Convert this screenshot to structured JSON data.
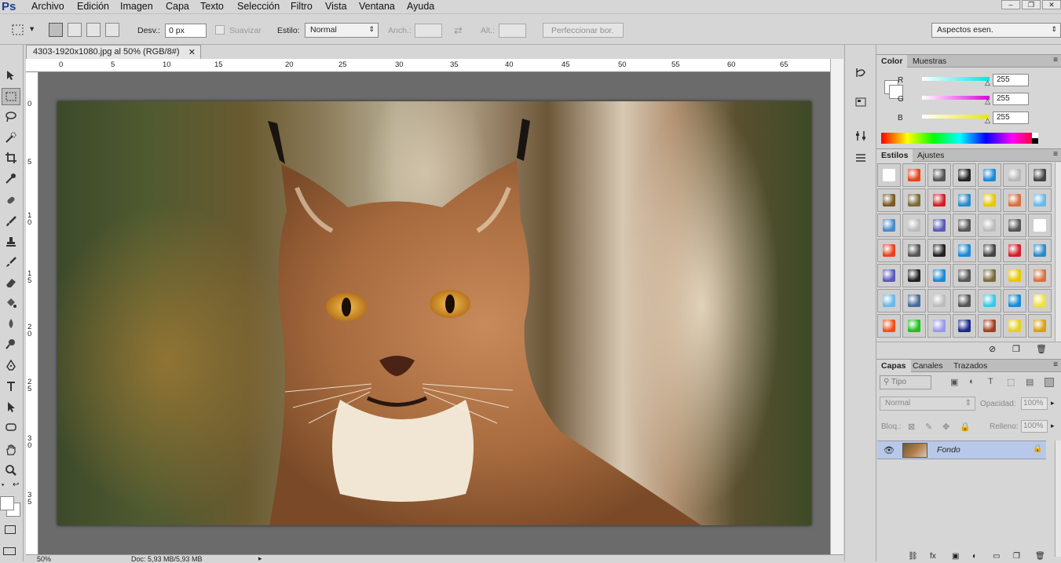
{
  "app": {
    "logo": "Ps"
  },
  "menu": [
    "Archivo",
    "Edición",
    "Imagen",
    "Capa",
    "Texto",
    "Selección",
    "Filtro",
    "Vista",
    "Ventana",
    "Ayuda"
  ],
  "options": {
    "desv_label": "Desv.:",
    "desv_value": "0 px",
    "suavizar_label": "Suavizar",
    "estilo_label": "Estilo:",
    "estilo_value": "Normal",
    "anch_label": "Anch.:",
    "alt_label": "Alt.:",
    "perfeccionar_label": "Perfeccionar bor.",
    "workspace_value": "Aspectos esen."
  },
  "document": {
    "tab_title": "4303-1920x1080.jpg al 50% (RGB/8#)",
    "zoom": "50%",
    "doc_info": "Doc: 5,93 MB/5,93 MB",
    "ruler_top": [
      "0",
      "5",
      "10",
      "15",
      "20",
      "25",
      "30",
      "35",
      "40",
      "45",
      "50",
      "55",
      "60",
      "65"
    ],
    "ruler_left": [
      "0",
      "5",
      "1 0",
      "1 5",
      "2 0",
      "2 5",
      "3 0",
      "3 5"
    ]
  },
  "color_panel": {
    "tabs": [
      "Color",
      "Muestras"
    ],
    "channels": [
      {
        "letter": "R",
        "value": "255",
        "color": "#00e5e5"
      },
      {
        "letter": "G",
        "value": "255",
        "color": "#e000e0"
      },
      {
        "letter": "B",
        "value": "255",
        "color": "#e8e800"
      }
    ]
  },
  "styles_panel": {
    "tabs": [
      "Estilos",
      "Ajustes"
    ],
    "swatches": [
      "#ffffff",
      "#e8421c",
      "#555555",
      "#222222",
      "#1a8ad4",
      "#b8b8b8",
      "#444444",
      "#7a5a2a",
      "#7a6a3a",
      "#d0202a",
      "#2a8ac8",
      "#e8c800",
      "#d87040",
      "#6ab8e8",
      "#4a8ac8",
      "#bcbcbc",
      "#5a5ab8",
      "#555555",
      "#bcbcbc",
      "#555555",
      "#ffffff",
      "#e8421c",
      "#555555",
      "#222222",
      "#1a8ad4",
      "#444444",
      "#d0202a",
      "#2a8ac8",
      "#5a5ab8",
      "#222222",
      "#1a8ad4",
      "#555555",
      "#7a6a3a",
      "#e8c800",
      "#d87040",
      "#6ab8e8",
      "#4a6a9a",
      "#bcbcbc",
      "#555555",
      "#3ac8e8",
      "#1a8ad4",
      "#f0e040",
      "#f0501a",
      "#20c020",
      "#9a9ae8",
      "#1a2a8a",
      "#a04020",
      "#e8d020",
      "#d8a010"
    ]
  },
  "layers_panel": {
    "tabs": [
      "Capas",
      "Canales",
      "Trazados"
    ],
    "filter_label": "Tipo",
    "blend_mode": "Normal",
    "opacity_label": "Opacidad:",
    "opacity_value": "100%",
    "lock_label": "Bloq.:",
    "fill_label": "Relleno:",
    "fill_value": "100%",
    "layers": [
      {
        "name": "Fondo"
      }
    ]
  },
  "icons": {
    "toolbar": [
      "move-icon",
      "marquee-icon",
      "lasso-icon",
      "quick-select-icon",
      "crop-icon",
      "eyedropper-icon",
      "healing-brush-icon",
      "brush-icon",
      "clone-stamp-icon",
      "history-brush-icon",
      "eraser-icon",
      "paint-bucket-icon",
      "blur-icon",
      "dodge-icon",
      "pen-icon",
      "type-icon",
      "path-select-icon",
      "shape-icon",
      "hand-icon",
      "zoom-icon"
    ]
  }
}
